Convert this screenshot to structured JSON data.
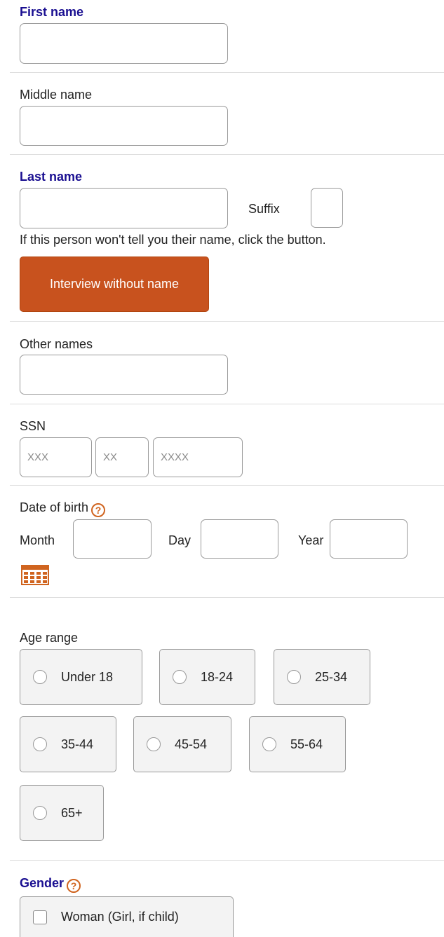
{
  "first_name": {
    "label": "First name",
    "value": ""
  },
  "middle_name": {
    "label": "Middle name",
    "value": ""
  },
  "last_name": {
    "label": "Last name",
    "value": ""
  },
  "suffix": {
    "label": "Suffix",
    "value": ""
  },
  "no_name": {
    "prompt": "If this person won't tell you their name, click the button.",
    "button_label": "Interview without name"
  },
  "other_names": {
    "label": "Other names",
    "value": ""
  },
  "ssn": {
    "label": "SSN",
    "part1_placeholder": "XXX",
    "part2_placeholder": "XX",
    "part3_placeholder": "XXXX"
  },
  "dob": {
    "label": "Date of birth",
    "help_icon": "help-icon",
    "month_label": "Month",
    "day_label": "Day",
    "year_label": "Year",
    "calendar_icon": "calendar-icon"
  },
  "age_range": {
    "label": "Age range",
    "options": [
      "Under 18",
      "18-24",
      "25-34",
      "35-44",
      "45-54",
      "55-64",
      "65+"
    ],
    "selected": null
  },
  "gender": {
    "label": "Gender",
    "help_icon": "help-icon",
    "options": [
      "Woman (Girl, if child)"
    ],
    "checked": [
      false
    ]
  },
  "colors": {
    "required_label": "#1a0f91",
    "accent_orange": "#c8521e",
    "border": "#9a9a9a",
    "option_bg": "#f3f3f3"
  }
}
